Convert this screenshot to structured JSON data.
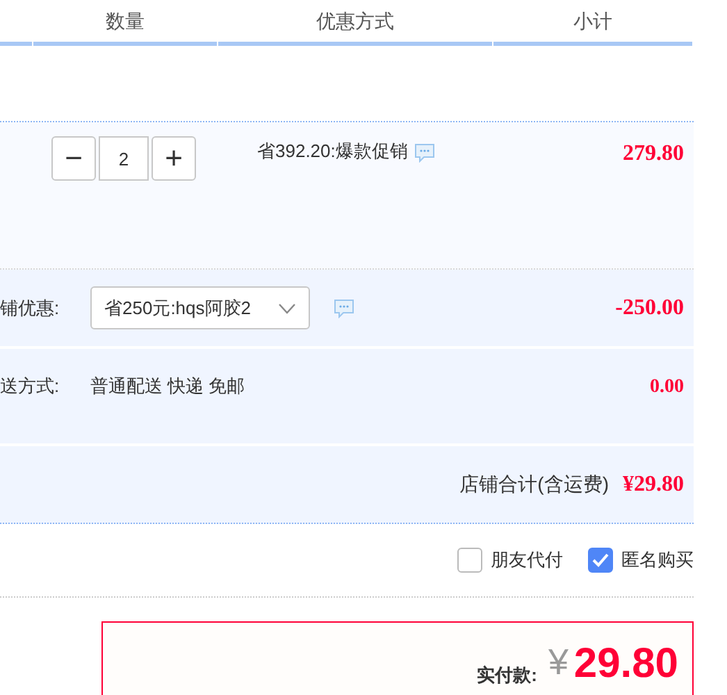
{
  "table": {
    "columns": [
      "数量",
      "优惠方式",
      "小计"
    ]
  },
  "item": {
    "quantity": "2",
    "minus": "−",
    "plus": "+",
    "promotion": "省392.20:爆款促销",
    "subtotal": "279.80"
  },
  "shop_discount": {
    "label": "铺优惠:",
    "selected_option": "省250元:hqs阿胶2",
    "amount": "-250.00"
  },
  "shipping": {
    "label": "送方式:",
    "method": "普通配送 快递 免邮",
    "amount": "0.00"
  },
  "shop_total": {
    "label": "店铺合计(含运费)",
    "amount": "¥29.80"
  },
  "options": [
    {
      "label": "朋友代付",
      "checked": false
    },
    {
      "label": "匿名购买",
      "checked": true
    }
  ],
  "payment": {
    "label": "实付款:",
    "currency": "¥",
    "amount": "29.80"
  }
}
